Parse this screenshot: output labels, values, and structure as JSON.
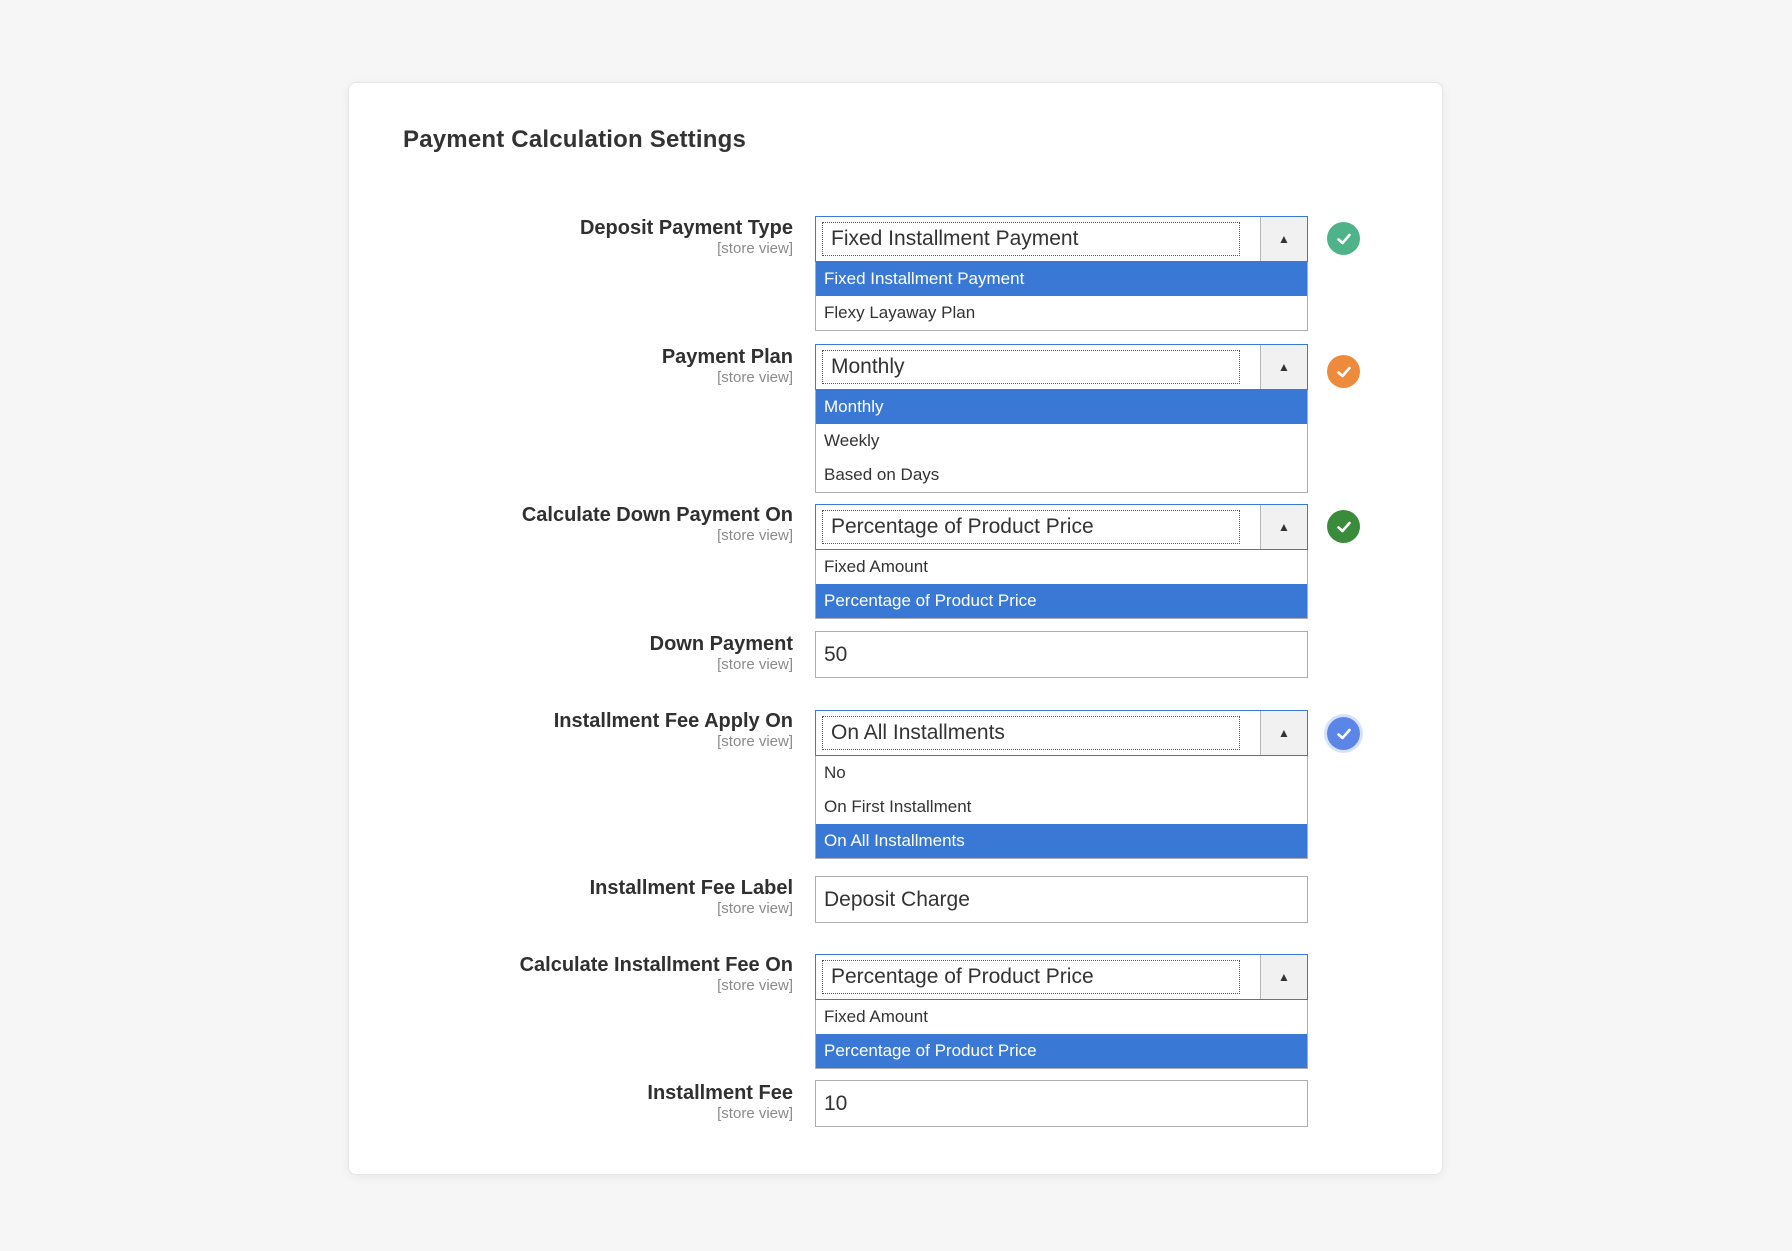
{
  "page": {
    "title": "Payment Calculation Settings"
  },
  "scope_label": "[store view]",
  "colors": {
    "selected_option": "#3a78d5",
    "badge_deposit": "#4fb38a",
    "badge_plan": "#ee8a3c",
    "badge_down": "#3a8c3c",
    "badge_fee_apply": "#5b86e8"
  },
  "fields": {
    "deposit_payment_type": {
      "label": "Deposit Payment Type",
      "value": "Fixed Installment Payment",
      "options": [
        "Fixed Installment Payment",
        "Flexy Layaway Plan"
      ],
      "badge_icon": "check-icon"
    },
    "payment_plan": {
      "label": "Payment Plan",
      "value": "Monthly",
      "options": [
        "Monthly",
        "Weekly",
        "Based on Days"
      ],
      "badge_icon": "check-icon"
    },
    "calculate_down_payment_on": {
      "label": "Calculate Down Payment On",
      "value": "Percentage of Product Price",
      "options": [
        "Fixed Amount",
        "Percentage of Product Price"
      ],
      "badge_icon": "check-icon"
    },
    "down_payment": {
      "label": "Down Payment",
      "value": "50"
    },
    "installment_fee_apply_on": {
      "label": "Installment Fee Apply On",
      "value": "On All Installments",
      "options": [
        "No",
        "On First Installment",
        "On All Installments"
      ],
      "badge_icon": "check-icon"
    },
    "installment_fee_label": {
      "label": "Installment Fee Label",
      "value": "Deposit Charge"
    },
    "calculate_installment_fee_on": {
      "label": "Calculate Installment Fee On",
      "value": "Percentage of Product Price",
      "options": [
        "Fixed Amount",
        "Percentage of Product Price"
      ]
    },
    "installment_fee": {
      "label": "Installment Fee",
      "value": "10"
    }
  }
}
